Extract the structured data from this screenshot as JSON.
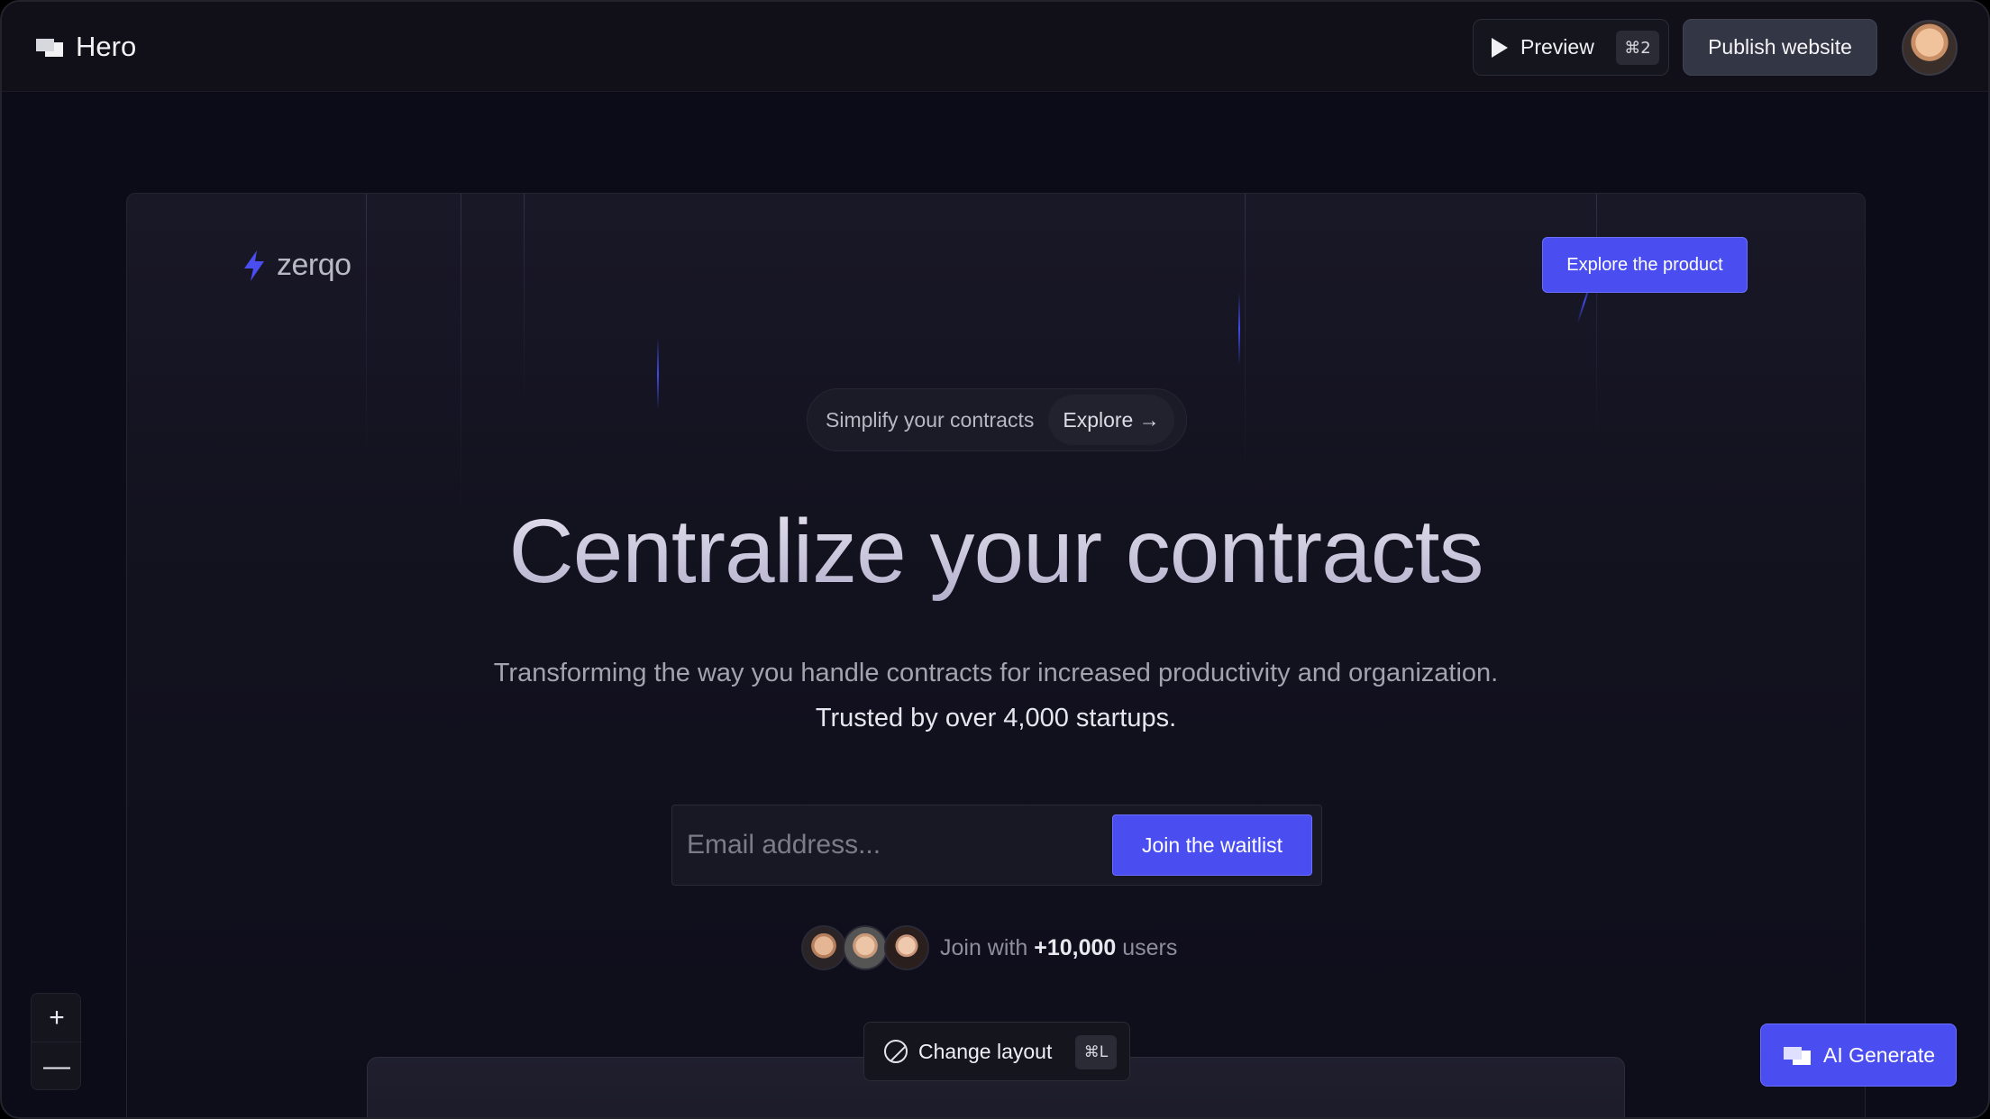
{
  "app": {
    "title": "Hero"
  },
  "toolbar": {
    "preview_label": "Preview",
    "preview_shortcut": "⌘2",
    "publish_label": "Publish website"
  },
  "site": {
    "logo_text": "zerqo",
    "header_cta": "Explore the product",
    "pill": {
      "text": "Simplify your contracts",
      "link": "Explore →"
    },
    "headline": "Centralize your contracts",
    "subheadline": "Transforming the way you handle contracts for increased productivity and organization.",
    "trust_line": "Trusted by over 4,000 startups.",
    "email_placeholder": "Email address...",
    "join_button": "Join the waitlist",
    "users_prefix": "Join with",
    "users_count": "+10,000",
    "users_suffix": "users"
  },
  "controls": {
    "zoom_in": "+",
    "zoom_out": "—",
    "change_layout_label": "Change layout",
    "change_layout_shortcut": "⌘L",
    "ai_generate_label": "AI Generate"
  },
  "colors": {
    "accent": "#4a4df0",
    "background": "#0c0b18",
    "topbar": "#111019"
  }
}
